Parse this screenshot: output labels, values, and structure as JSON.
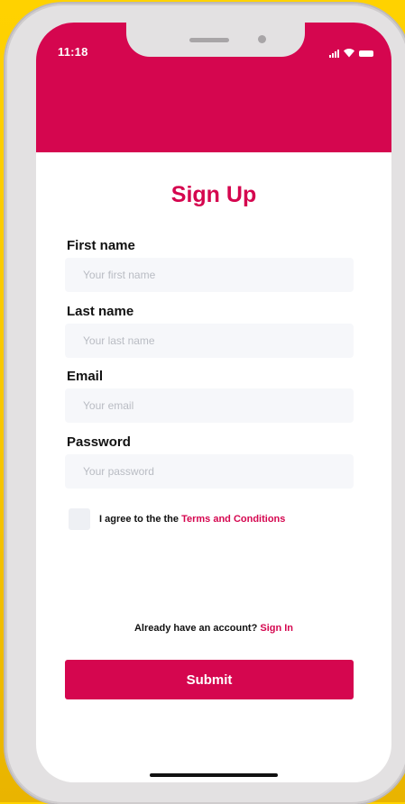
{
  "status_bar": {
    "time": "11:18",
    "icons": [
      "signal-icon",
      "wifi-icon",
      "battery-icon"
    ]
  },
  "title": "Sign Up",
  "fields": [
    {
      "label": "First name",
      "placeholder": "Your first name"
    },
    {
      "label": "Last name",
      "placeholder": "Your last name"
    },
    {
      "label": "Email",
      "placeholder": "Your email"
    },
    {
      "label": "Password",
      "placeholder": "Your password"
    }
  ],
  "agree": {
    "text": "I agree to the the ",
    "link": "Terms and Conditions",
    "checked": false
  },
  "signin": {
    "text": "Already have an account? ",
    "link": "Sign In"
  },
  "submit_label": "Submit",
  "colors": {
    "brand": "#d5064f",
    "background": "#ffd200",
    "input": "#f6f7fa"
  }
}
